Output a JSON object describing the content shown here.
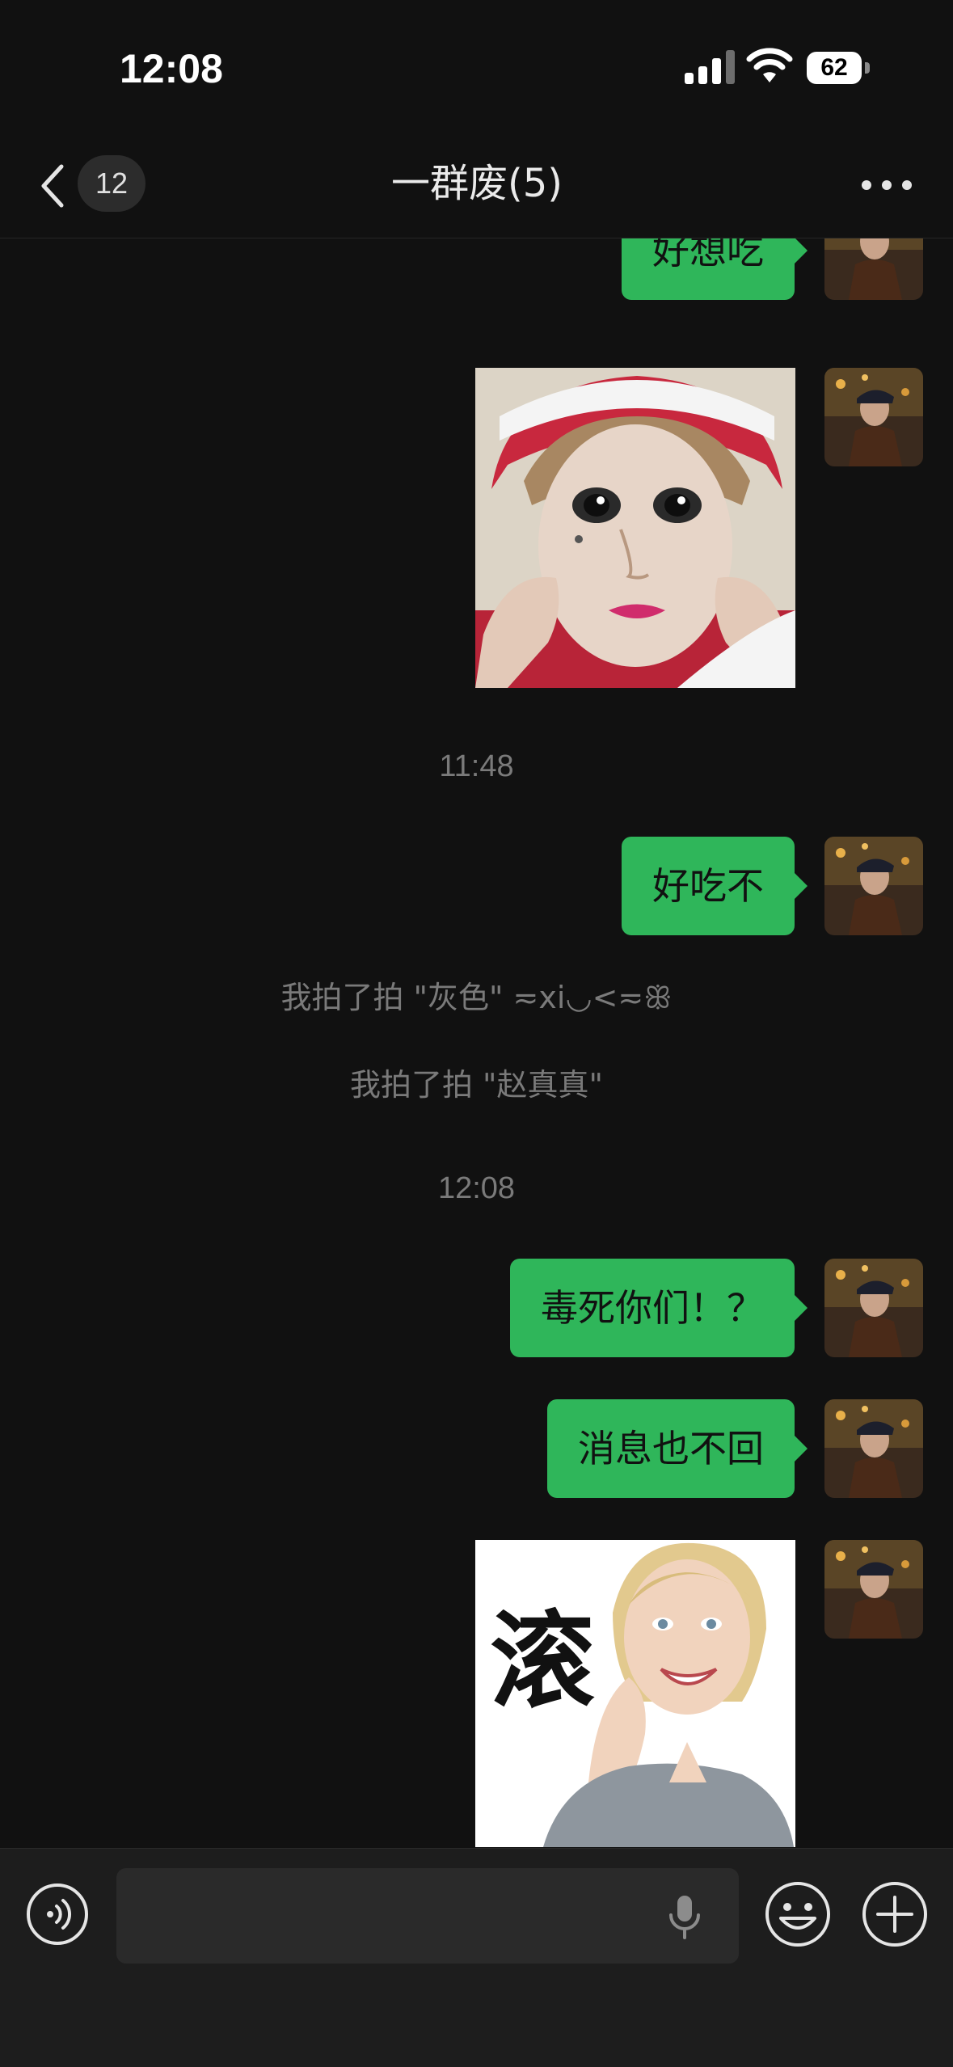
{
  "status_bar": {
    "time": "12:08",
    "battery": "62"
  },
  "nav": {
    "back_count": "12",
    "title": "一群废(5)"
  },
  "messages": {
    "m1": "好想吃",
    "ts1": "11:48",
    "m2": "好吃不",
    "sys1": "我拍了拍 \"灰色\" ≂xi◡<≂ꕥ",
    "sys2": "我拍了拍 \"赵真真\"",
    "ts2": "12:08",
    "m3": "毒死你们！？",
    "m4": "消息也不回",
    "sticker2_text": "滚"
  },
  "colors": {
    "background": "#111111",
    "bubble_green": "#2fb65a",
    "input_bar": "#1d1d1d",
    "muted_text": "#7a7a7a"
  },
  "icons": [
    "chevron-left-icon",
    "more-icon",
    "voice-icon",
    "microphone-icon",
    "emoji-icon",
    "plus-icon"
  ]
}
